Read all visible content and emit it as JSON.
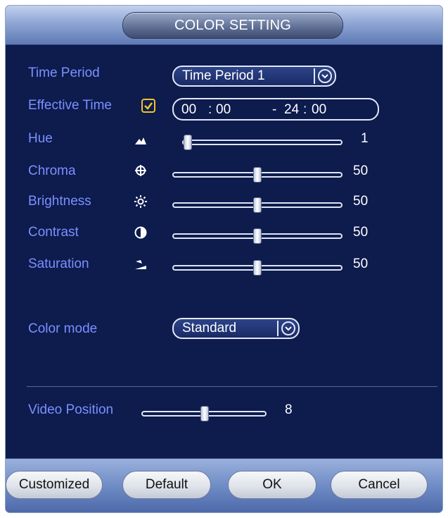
{
  "dialog": {
    "title": "COLOR SETTING"
  },
  "time_period": {
    "label": "Time Period",
    "selected": "Time Period 1"
  },
  "effective_time": {
    "label": "Effective Time",
    "checked": true,
    "start_hour": "00",
    "start_min": "00",
    "end_hour": "24",
    "end_min": "00",
    "colon": ":",
    "dash": "- "
  },
  "adjustments": [
    {
      "label": "Hue",
      "icon": "hue-icon",
      "value": "1",
      "level": 1
    },
    {
      "label": "Chroma",
      "icon": "chroma-icon",
      "value": "50",
      "level": 50
    },
    {
      "label": "Brightness",
      "icon": "brightness-icon",
      "value": "50",
      "level": 50
    },
    {
      "label": "Contrast",
      "icon": "contrast-icon",
      "value": "50",
      "level": 50
    },
    {
      "label": "Saturation",
      "icon": "saturation-icon",
      "value": "50",
      "level": 50
    }
  ],
  "color_mode": {
    "label": "Color mode",
    "selected": "Standard"
  },
  "video_position": {
    "label": "Video Position",
    "value": "8",
    "level_fraction": 0.5
  },
  "buttons": {
    "customized": "Customized",
    "default": "Default",
    "ok": "OK",
    "cancel": "Cancel"
  },
  "colors": {
    "background": "#0d1b4d",
    "label": "#7d8fff",
    "value": "#ffffff",
    "checkbox": "#f2c230"
  }
}
